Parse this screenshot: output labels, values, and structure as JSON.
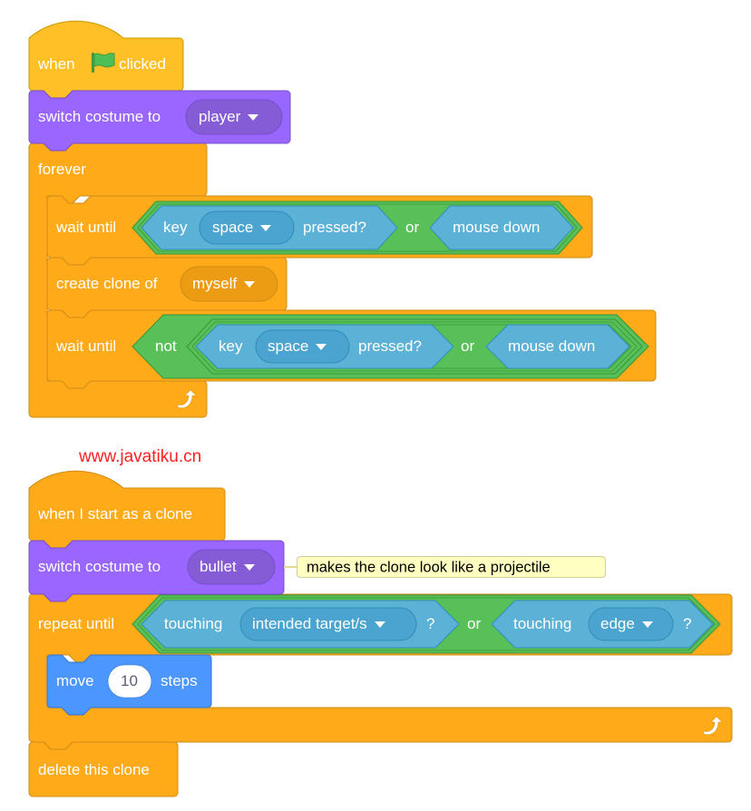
{
  "watermark": "www.javatiku.cn",
  "colors": {
    "events": "#ffbf26",
    "looks": "#9966ff",
    "looks_menu": "#855cd6",
    "control": "#ffab19",
    "control_menu": "#ec9c13",
    "operators": "#59c059",
    "sensing": "#5cb1d6",
    "sensing_menu": "#4aa4cf",
    "motion": "#4c97ff",
    "comment_bg": "#feffc0"
  },
  "stack1": {
    "hat": {
      "prefix": "when",
      "icon": "green-flag-icon",
      "suffix": "clicked"
    },
    "switch_costume": {
      "label": "switch costume to",
      "menu_value": "player"
    },
    "forever": {
      "label": "forever",
      "loop_icon": "loop-arrow-icon",
      "body": [
        {
          "type": "wait_until",
          "label": "wait until",
          "condition": {
            "op": "or",
            "left": {
              "prefix": "key",
              "menu_value": "space",
              "suffix": "pressed?"
            },
            "right": {
              "label": "mouse down"
            }
          }
        },
        {
          "type": "create_clone",
          "label": "create clone of",
          "menu_value": "myself"
        },
        {
          "type": "wait_until",
          "label": "wait until",
          "condition": {
            "op": "not",
            "inner": {
              "op": "or",
              "left": {
                "prefix": "key",
                "menu_value": "space",
                "suffix": "pressed?"
              },
              "right": {
                "label": "mouse down"
              }
            }
          }
        }
      ]
    }
  },
  "stack2": {
    "hat": {
      "label": "when I start as a clone"
    },
    "switch_costume": {
      "label": "switch costume to",
      "menu_value": "bullet"
    },
    "comment": "makes the clone look like a projectile",
    "repeat_until": {
      "label": "repeat until",
      "loop_icon": "loop-arrow-icon",
      "condition": {
        "op": "or",
        "left": {
          "prefix": "touching",
          "menu_value": "intended target/s",
          "suffix": "?"
        },
        "right": {
          "prefix": "touching",
          "menu_value": "edge",
          "suffix": "?"
        }
      },
      "body": [
        {
          "type": "move",
          "prefix": "move",
          "value": "10",
          "suffix": "steps"
        }
      ]
    },
    "delete_clone": {
      "label": "delete this clone"
    }
  }
}
